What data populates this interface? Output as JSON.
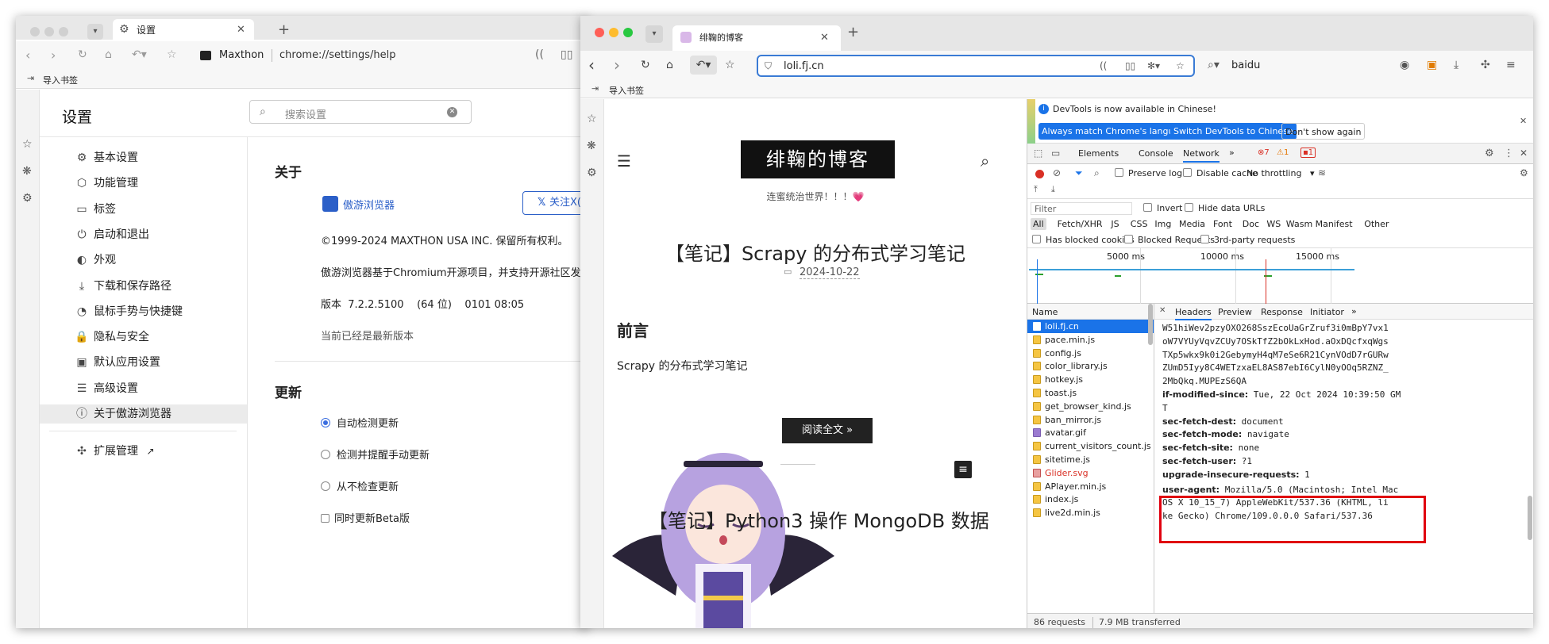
{
  "left": {
    "tab_title": "设置",
    "brand": "Maxthon",
    "url": "chrome://settings/help",
    "bookmark_import": "导入书签",
    "settings_title": "设置",
    "search_placeholder": "搜索设置",
    "nav": [
      {
        "label": "基本设置",
        "icon": "gear-icon"
      },
      {
        "label": "功能管理",
        "icon": "cube-icon"
      },
      {
        "label": "标签",
        "icon": "tab-icon"
      },
      {
        "label": "启动和退出",
        "icon": "power-icon"
      },
      {
        "label": "外观",
        "icon": "palette-icon"
      },
      {
        "label": "下载和保存路径",
        "icon": "download-icon"
      },
      {
        "label": "鼠标手势与快捷键",
        "icon": "mouse-icon"
      },
      {
        "label": "隐私与安全",
        "icon": "lock-icon"
      },
      {
        "label": "默认应用设置",
        "icon": "app-icon"
      },
      {
        "label": "高级设置",
        "icon": "sliders-icon"
      },
      {
        "label": "关于傲游浏览器",
        "icon": "info-icon"
      }
    ],
    "ext_label": "扩展管理",
    "about_heading": "关于",
    "logo_text": "傲游浏览器",
    "follow_btn": "关注X(T",
    "copyright": "©1999-2024 MAXTHON USA INC. 保留所有权利。",
    "based_on": "傲游浏览器基于Chromium开源项目，并支持开源社区发展",
    "version": "版本  7.2.2.5100    (64 位)    0101 08:05",
    "latest": "当前已经是最新版本",
    "update_heading": "更新",
    "options": [
      "自动检测更新",
      "检测并提醒手动更新",
      "从不检查更新"
    ],
    "beta": "同时更新Beta版"
  },
  "right": {
    "tab_title": "绯鞠的博客",
    "url": "loli.fj.cn",
    "search_engine": "baidu",
    "bookmark_import": "导入书签",
    "blog_title": "绯鞠的博客",
    "blog_subtitle": "连蜜统治世界！！！💗",
    "post_title": "【笔记】Scrapy 的分布式学习笔记",
    "post_date": "2024-10-22",
    "section_heading": "前言",
    "post_excerpt": "Scrapy 的分布式学习笔记",
    "read_more": "阅读全文 »",
    "next_post_partial": "【笔记】Python3 操作 MongoDB 数据"
  },
  "devtools": {
    "notice": "DevTools is now available in Chinese!",
    "btn_match": "Always match Chrome's language",
    "btn_switch": "Switch DevTools to Chinese",
    "btn_dont": "Don't show again",
    "tabs": [
      "Elements",
      "Console",
      "Network"
    ],
    "err_count": "7",
    "warn_count": "1",
    "issue_count": "1",
    "preserve_log": "Preserve log",
    "disable_cache": "Disable cache",
    "throttling": "No throttling",
    "filter_placeholder": "Filter",
    "invert": "Invert",
    "hide_data_urls": "Hide data URLs",
    "types": [
      "All",
      "Fetch/XHR",
      "JS",
      "CSS",
      "Img",
      "Media",
      "Font",
      "Doc",
      "WS",
      "Wasm",
      "Manifest",
      "Other"
    ],
    "has_blocked_cookies": "Has blocked cookies",
    "blocked_requests": "Blocked Requests",
    "third_party": "3rd-party requests",
    "timeline_ticks": [
      "5000 ms",
      "10000 ms",
      "15000 ms"
    ],
    "name_header": "Name",
    "files": [
      "loli.fj.cn",
      "pace.min.js",
      "config.js",
      "color_library.js",
      "hotkey.js",
      "toast.js",
      "get_browser_kind.js",
      "ban_mirror.js",
      "avatar.gif",
      "current_visitors_count.js",
      "sitetime.js",
      "Glider.svg",
      "APlayer.min.js",
      "index.js",
      "live2d.min.js"
    ],
    "detail_tabs": [
      "Headers",
      "Preview",
      "Response",
      "Initiator"
    ],
    "hash_lines": [
      "W51hiWev2pzyOXO268SszEcoUaGrZruf3i0mBpY7vx1",
      "oW7VYUyVqvZCUy7OSkTfZ2bOkLxHod.aOxDQcfxqWgs",
      "TXp5wkx9k0i2GebymyH4qM7eSe6R21CynVOdD7rGURw",
      "ZUmD5Iyy8C4WETzxaEL8AS87ebI6CylN0yOOq5RZNZ_",
      "2MbQkq.MUPEzS6QA"
    ],
    "headers": [
      {
        "k": "if-modified-since:",
        "v": " Tue, 22 Oct 2024 10:39:50 GM"
      },
      {
        "k": "",
        "v": "T"
      },
      {
        "k": "sec-fetch-dest:",
        "v": " document"
      },
      {
        "k": "sec-fetch-mode:",
        "v": " navigate"
      },
      {
        "k": "sec-fetch-site:",
        "v": " none"
      },
      {
        "k": "sec-fetch-user:",
        "v": " ?1"
      },
      {
        "k": "upgrade-insecure-requests:",
        "v": " 1"
      }
    ],
    "ua_key": "user-agent:",
    "ua_lines": [
      " Mozilla/5.0 (Macintosh; Intel Mac",
      "OS X 10_15_7) AppleWebKit/537.36 (KHTML, li",
      "ke Gecko) Chrome/109.0.0.0 Safari/537.36"
    ],
    "status_requests": "86 requests",
    "status_transferred": "7.9 MB transferred"
  }
}
